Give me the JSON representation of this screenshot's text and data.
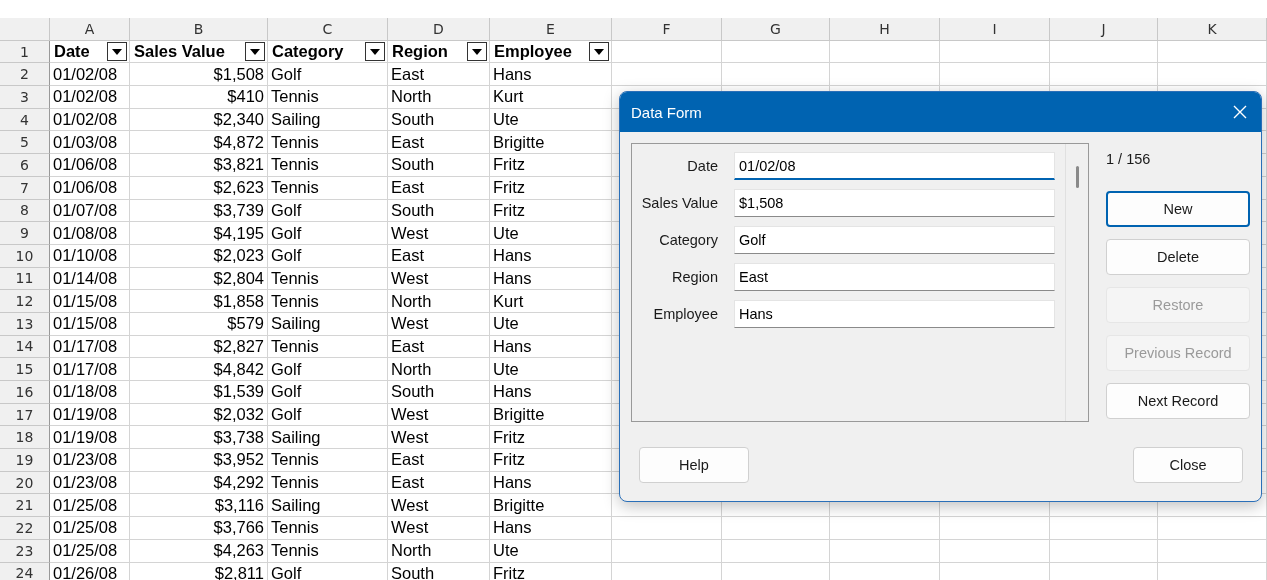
{
  "sheet": {
    "columns": [
      "A",
      "B",
      "C",
      "D",
      "E",
      "F",
      "G",
      "H",
      "I",
      "J",
      "K"
    ],
    "header_row": {
      "number": "1",
      "cells": [
        "Date",
        "Sales Value",
        "Category",
        "Region",
        "Employee"
      ]
    },
    "rows": [
      {
        "number": "2",
        "cells": [
          "01/02/08",
          "$1,508",
          "Golf",
          "East",
          "Hans"
        ]
      },
      {
        "number": "3",
        "cells": [
          "01/02/08",
          "$410",
          "Tennis",
          "North",
          "Kurt"
        ]
      },
      {
        "number": "4",
        "cells": [
          "01/02/08",
          "$2,340",
          "Sailing",
          "South",
          "Ute"
        ]
      },
      {
        "number": "5",
        "cells": [
          "01/03/08",
          "$4,872",
          "Tennis",
          "East",
          "Brigitte"
        ]
      },
      {
        "number": "6",
        "cells": [
          "01/06/08",
          "$3,821",
          "Tennis",
          "South",
          "Fritz"
        ]
      },
      {
        "number": "7",
        "cells": [
          "01/06/08",
          "$2,623",
          "Tennis",
          "East",
          "Fritz"
        ]
      },
      {
        "number": "8",
        "cells": [
          "01/07/08",
          "$3,739",
          "Golf",
          "South",
          "Fritz"
        ]
      },
      {
        "number": "9",
        "cells": [
          "01/08/08",
          "$4,195",
          "Golf",
          "West",
          "Ute"
        ]
      },
      {
        "number": "10",
        "cells": [
          "01/10/08",
          "$2,023",
          "Golf",
          "East",
          "Hans"
        ]
      },
      {
        "number": "11",
        "cells": [
          "01/14/08",
          "$2,804",
          "Tennis",
          "West",
          "Hans"
        ]
      },
      {
        "number": "12",
        "cells": [
          "01/15/08",
          "$1,858",
          "Tennis",
          "North",
          "Kurt"
        ]
      },
      {
        "number": "13",
        "cells": [
          "01/15/08",
          "$579",
          "Sailing",
          "West",
          "Ute"
        ]
      },
      {
        "number": "14",
        "cells": [
          "01/17/08",
          "$2,827",
          "Tennis",
          "East",
          "Hans"
        ]
      },
      {
        "number": "15",
        "cells": [
          "01/17/08",
          "$4,842",
          "Golf",
          "North",
          "Ute"
        ]
      },
      {
        "number": "16",
        "cells": [
          "01/18/08",
          "$1,539",
          "Golf",
          "South",
          "Hans"
        ]
      },
      {
        "number": "17",
        "cells": [
          "01/19/08",
          "$2,032",
          "Golf",
          "West",
          "Brigitte"
        ]
      },
      {
        "number": "18",
        "cells": [
          "01/19/08",
          "$3,738",
          "Sailing",
          "West",
          "Fritz"
        ]
      },
      {
        "number": "19",
        "cells": [
          "01/23/08",
          "$3,952",
          "Tennis",
          "East",
          "Fritz"
        ]
      },
      {
        "number": "20",
        "cells": [
          "01/23/08",
          "$4,292",
          "Tennis",
          "East",
          "Hans"
        ]
      },
      {
        "number": "21",
        "cells": [
          "01/25/08",
          "$3,116",
          "Sailing",
          "West",
          "Brigitte"
        ]
      },
      {
        "number": "22",
        "cells": [
          "01/25/08",
          "$3,766",
          "Tennis",
          "West",
          "Hans"
        ]
      },
      {
        "number": "23",
        "cells": [
          "01/25/08",
          "$4,263",
          "Tennis",
          "North",
          "Ute"
        ]
      },
      {
        "number": "24",
        "cells": [
          "01/26/08",
          "$2,811",
          "Golf",
          "South",
          "Fritz"
        ]
      }
    ]
  },
  "dialog": {
    "title": "Data Form",
    "record_count": "1 / 156",
    "fields": [
      {
        "label": "Date",
        "value": "01/02/08",
        "focused": true
      },
      {
        "label": "Sales Value",
        "value": "$1,508",
        "focused": false
      },
      {
        "label": "Category",
        "value": "Golf",
        "focused": false
      },
      {
        "label": "Region",
        "value": "East",
        "focused": false
      },
      {
        "label": "Employee",
        "value": "Hans",
        "focused": false
      }
    ],
    "side_buttons": [
      {
        "label": "New",
        "default": true,
        "disabled": false
      },
      {
        "label": "Delete",
        "default": false,
        "disabled": false
      },
      {
        "label": "Restore",
        "default": false,
        "disabled": true
      },
      {
        "label": "Previous Record",
        "default": false,
        "disabled": true
      },
      {
        "label": "Next Record",
        "default": false,
        "disabled": false
      }
    ],
    "footer_buttons": [
      {
        "label": "Help"
      },
      {
        "label": "Close"
      }
    ]
  }
}
